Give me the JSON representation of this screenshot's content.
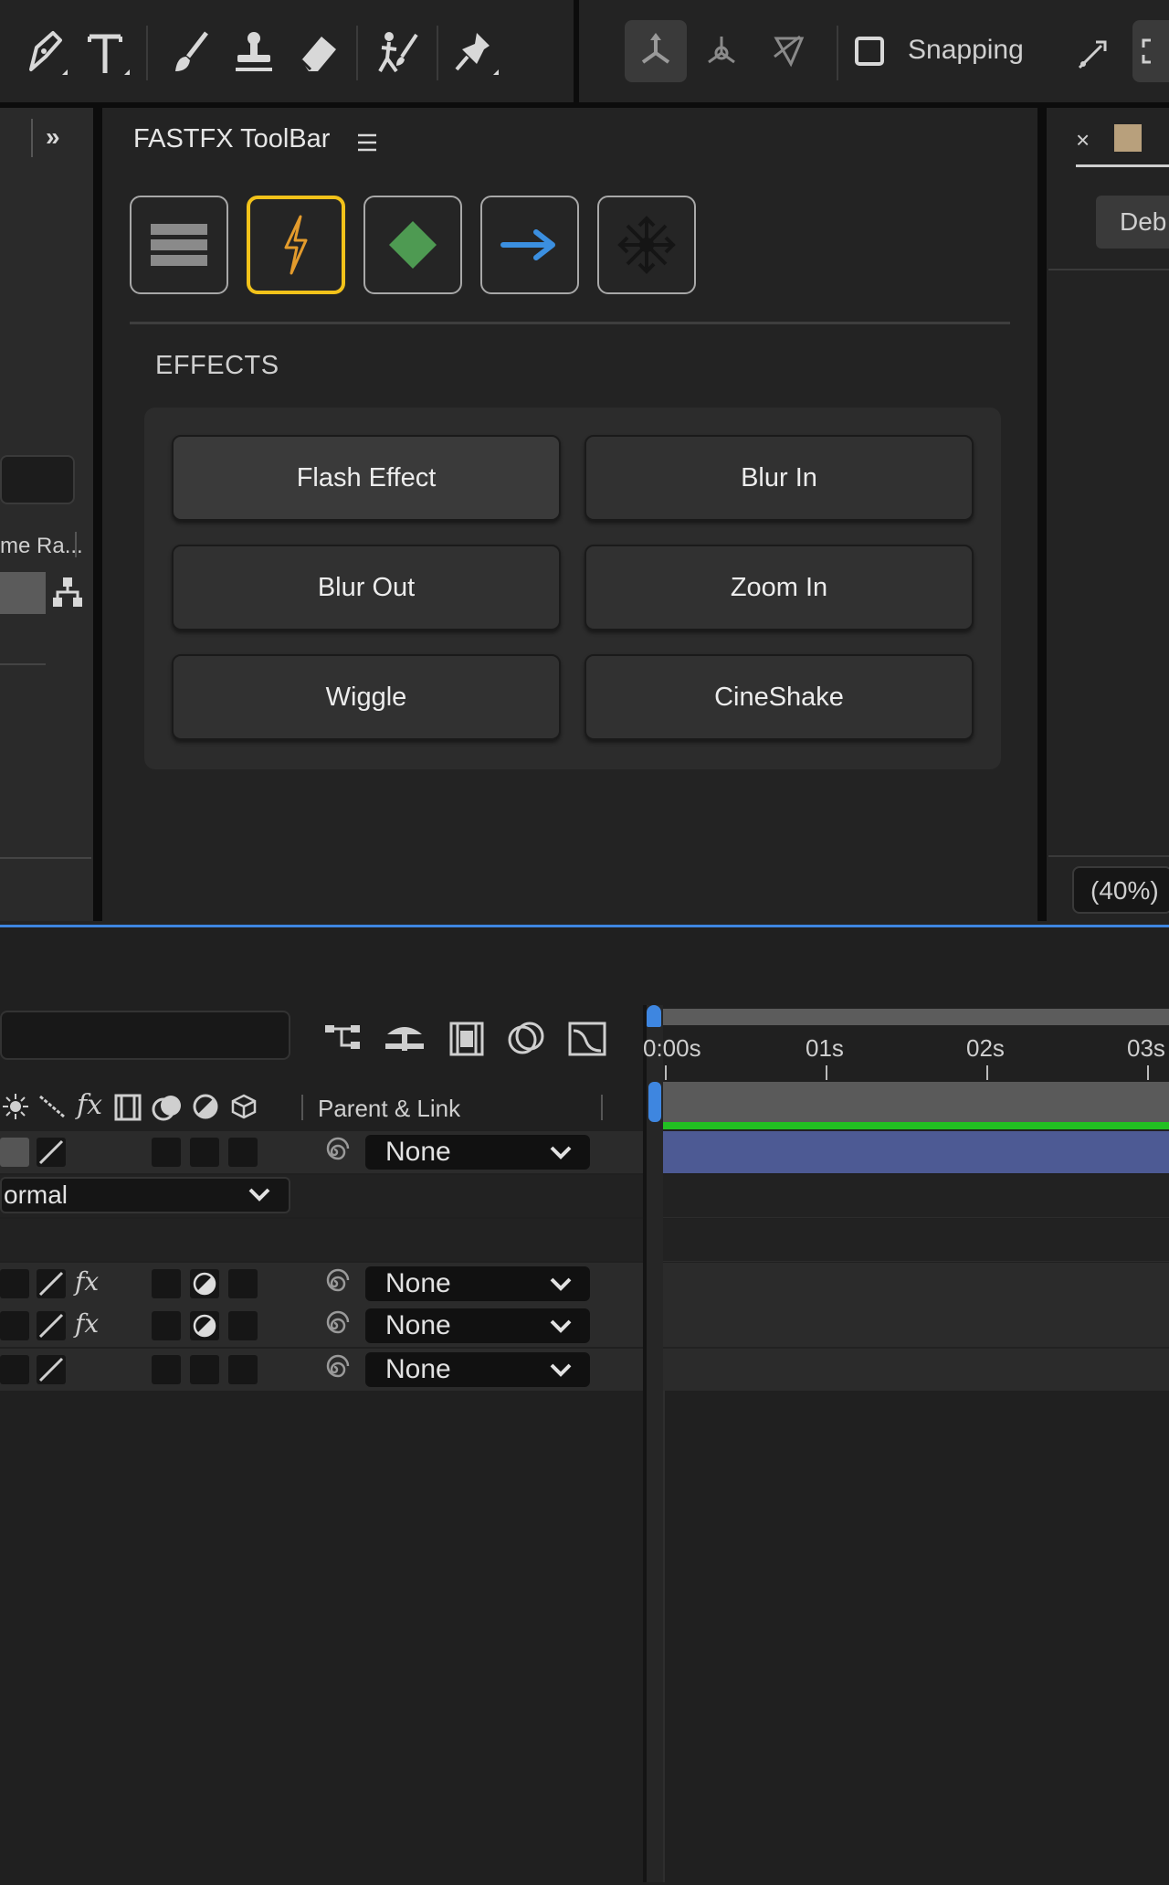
{
  "toolbar": {
    "tools": [
      {
        "icon": "pen-icon"
      },
      {
        "icon": "text-icon"
      },
      {
        "icon": "brush-icon"
      },
      {
        "icon": "clone-stamp-icon"
      },
      {
        "icon": "eraser-icon"
      },
      {
        "icon": "roto-brush-icon"
      },
      {
        "icon": "puppet-pin-icon"
      }
    ],
    "axis_modes": [
      "local-axis-icon",
      "world-axis-icon",
      "view-axis-icon"
    ],
    "snapping_label": "Snapping",
    "snapping_checked": false
  },
  "fastfx": {
    "title": "FASTFX ToolBar",
    "modes": [
      {
        "name": "menu",
        "icon": "stack-lines-icon",
        "active": false
      },
      {
        "name": "effects",
        "icon": "lightning-icon",
        "active": true,
        "color": "#e39b2c"
      },
      {
        "name": "keyframes",
        "icon": "green-diamond-icon",
        "active": false,
        "color": "#4e9a52"
      },
      {
        "name": "transitions",
        "icon": "blue-arrow-icon",
        "active": false,
        "color": "#3b8fe0"
      },
      {
        "name": "transform",
        "icon": "move-arrows-icon",
        "active": false
      }
    ],
    "section_label": "EFFECTS",
    "effects": [
      "Flash Effect",
      "Blur In",
      "Blur Out",
      "Zoom In",
      "Wiggle",
      "CineShake"
    ]
  },
  "left_panel": {
    "column_label": "me Ra..."
  },
  "right_panel": {
    "button_label": "Deb",
    "zoom_label": "(40%)",
    "swatch_color": "#b8a07c"
  },
  "timeline": {
    "parent_link_header": "Parent & Link",
    "mode_value": "ormal",
    "ruler_ticks": [
      "0:00s",
      "01s",
      "02s",
      "03s"
    ],
    "layers": [
      {
        "parent": "None"
      },
      {
        "parent": "None"
      },
      {
        "parent": "None"
      },
      {
        "parent": "None"
      }
    ],
    "colors": {
      "accent": "#3e86e0",
      "work_area": "#22c022",
      "layer_bar": "#4d5a94"
    }
  }
}
